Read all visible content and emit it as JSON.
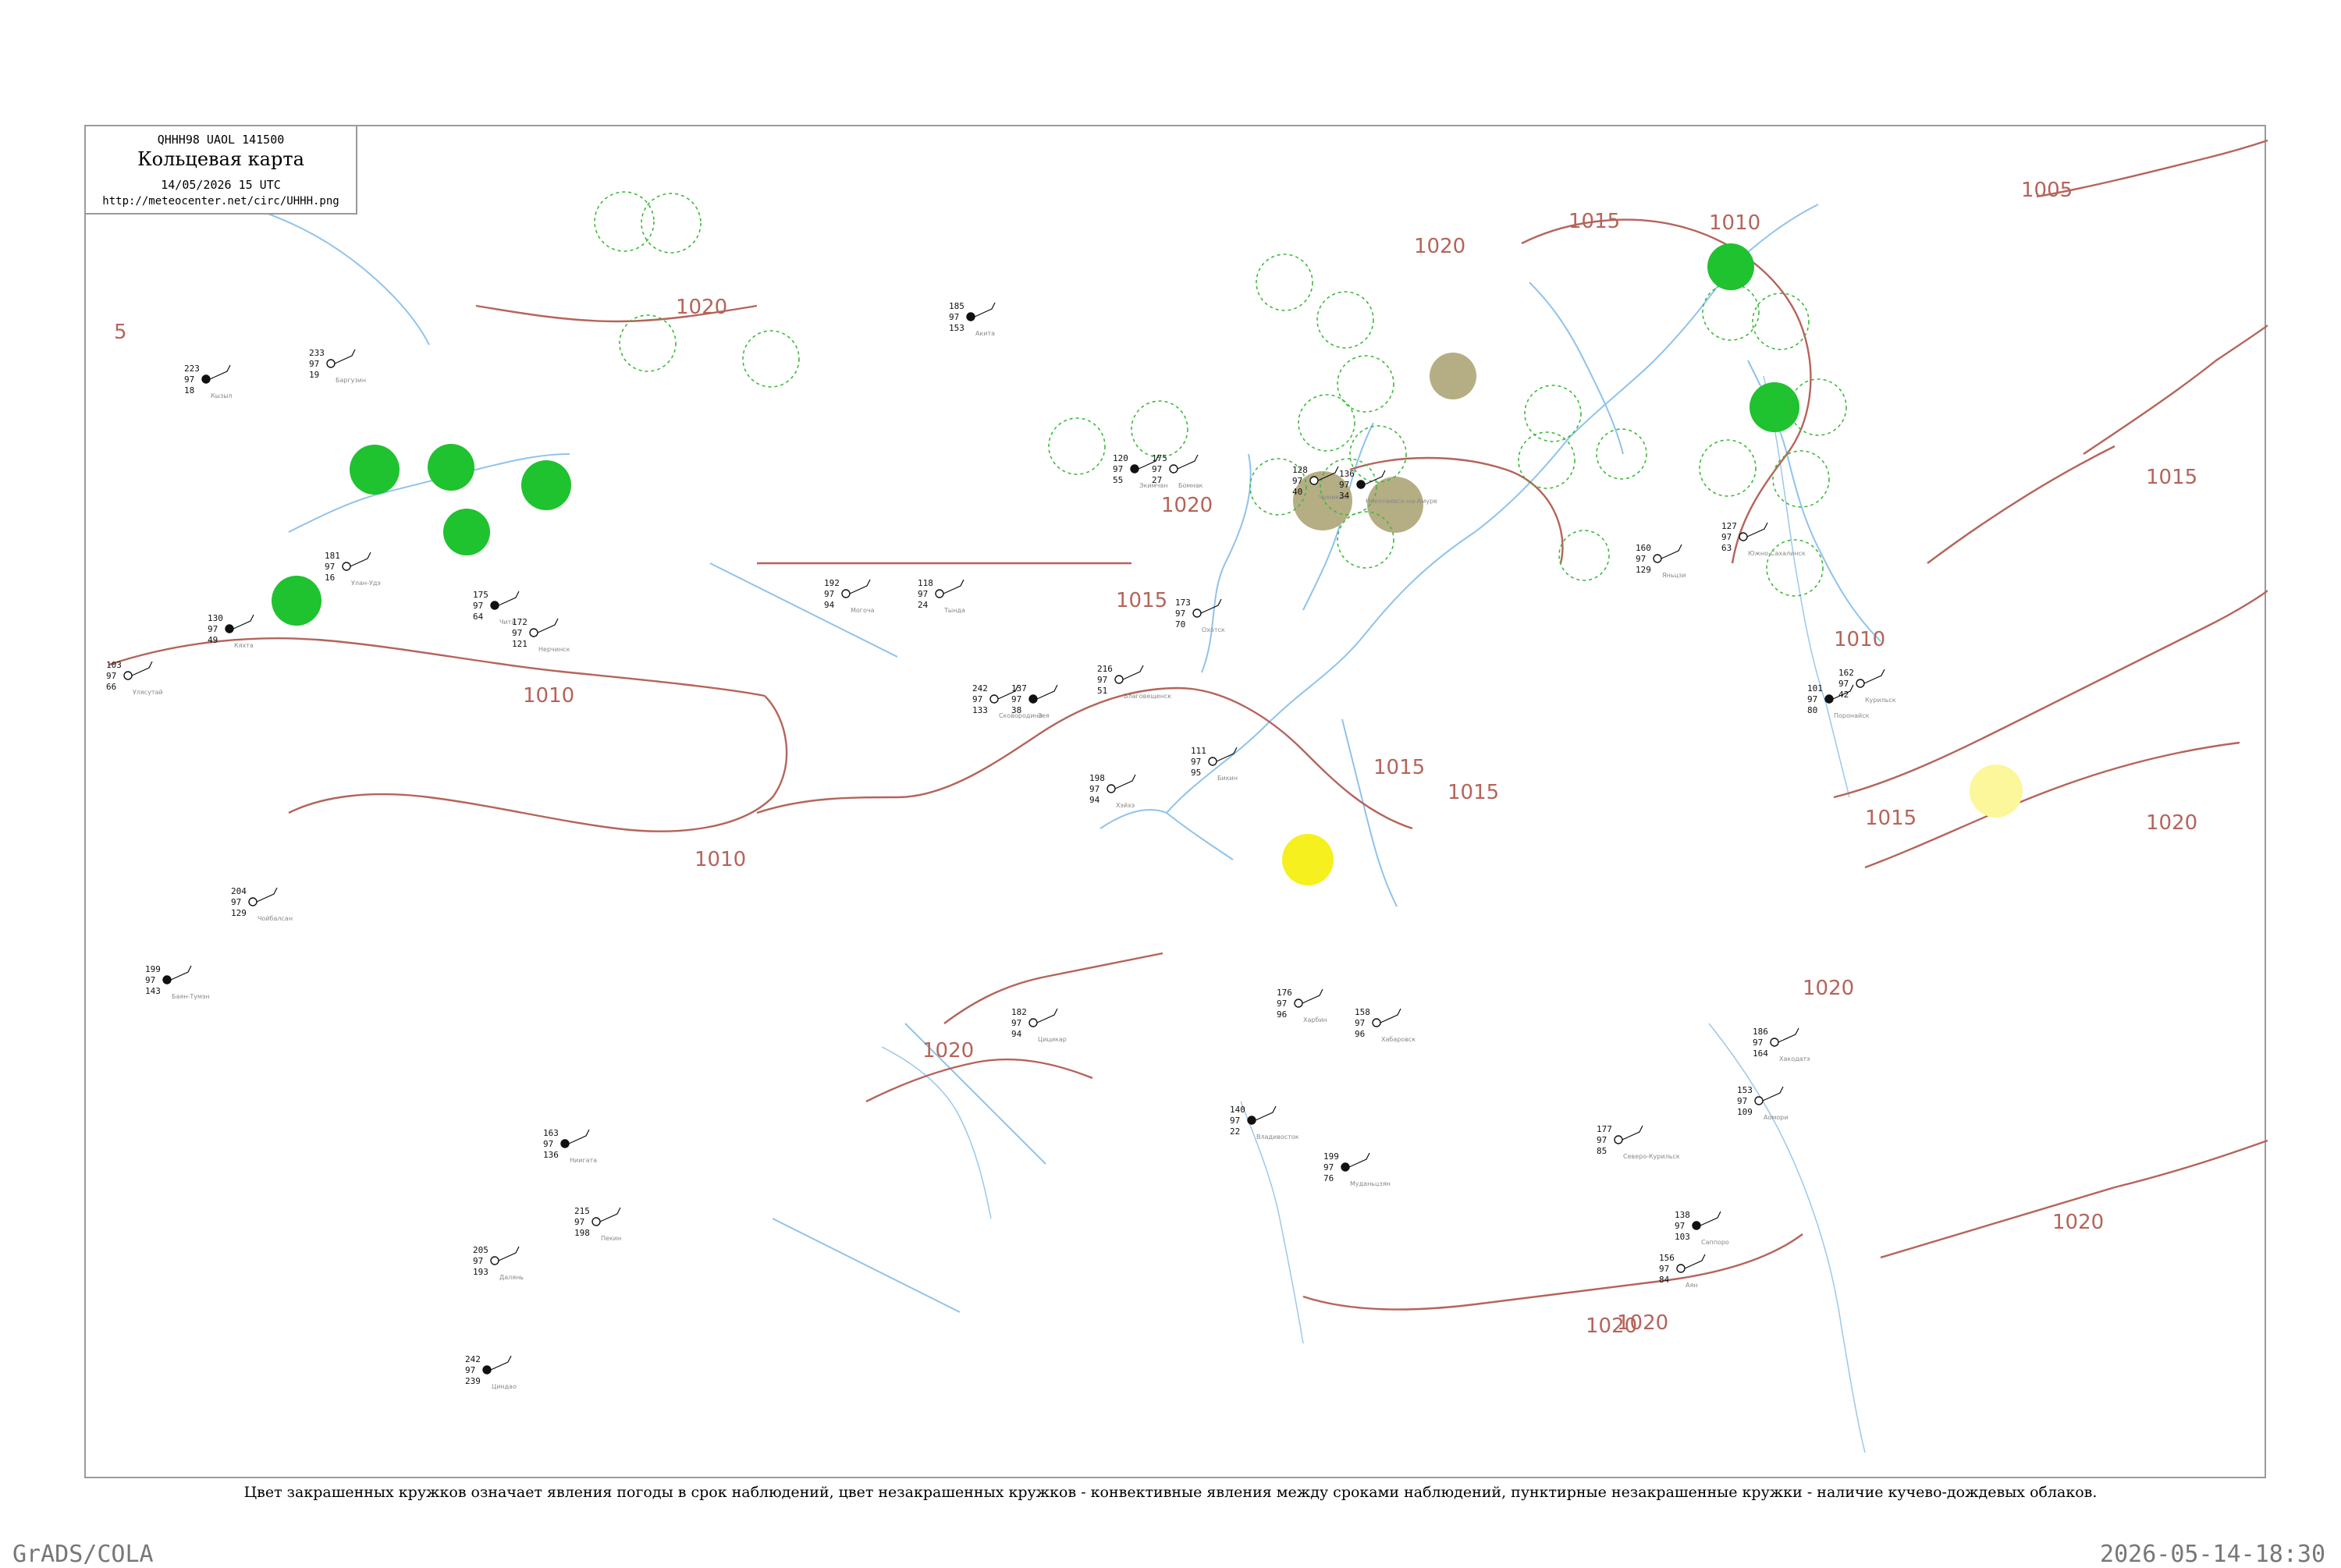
{
  "header": {
    "code": "QHHH98 UAOL 141500",
    "title": "Кольцевая карта",
    "date": "14/05/2026 15 UTC",
    "url": "http://meteocenter.net/circ/UHHH.png"
  },
  "footnote": "Цвет закрашенных кружков означает явления погоды в срок наблюдений, цвет незакрашенных кружков - конвективные явления между сроками наблюдений, пунктирные незакрашенные кружки - наличие кучево-дождевых облаков.",
  "footer": {
    "left": "GrADS/COLA",
    "right": "2026-05-14-18:30"
  },
  "colors": {
    "isobar": "#b5645a",
    "river": "#8fc3ec",
    "precip_green": "#1fc22f",
    "thunder_olive": "#b5ae84",
    "shower_yellow": "#f5f01e",
    "cb_dashed": "#3cba3c"
  },
  "isobars": [
    {
      "label": "1005",
      "name": "isobar-1005"
    },
    {
      "label": "1010",
      "name": "isobar-1010"
    },
    {
      "label": "1015",
      "name": "isobar-1015"
    },
    {
      "label": "1020",
      "name": "isobar-1020"
    },
    {
      "label": "5",
      "name": "isobar-partial"
    }
  ],
  "stations": [
    {
      "t": "223",
      "p": "97",
      "d": "18",
      "name": "Кызыл"
    },
    {
      "t": "233",
      "p": "97",
      "d": "19",
      "name": "Баргузин"
    },
    {
      "t": "181",
      "p": "97",
      "d": "16",
      "name": "Улан-Удэ"
    },
    {
      "t": "130",
      "p": "97",
      "d": "49",
      "name": "Кяхта"
    },
    {
      "t": "103",
      "p": "97",
      "d": "66",
      "name": "Улясутай"
    },
    {
      "t": "204",
      "p": "97",
      "d": "129",
      "name": "Чойбалсан"
    },
    {
      "t": "199",
      "p": "97",
      "d": "143",
      "name": "Баян-Тумэн"
    },
    {
      "t": "192",
      "p": "97",
      "d": "94",
      "name": "Могоча"
    },
    {
      "t": "118",
      "p": "97",
      "d": "24",
      "name": "Тында"
    },
    {
      "t": "175",
      "p": "97",
      "d": "64",
      "name": "Чита"
    },
    {
      "t": "172",
      "p": "97",
      "d": "121",
      "name": "Нерчинск"
    },
    {
      "t": "242",
      "p": "97",
      "d": "133",
      "name": "Сковородино"
    },
    {
      "t": "137",
      "p": "97",
      "d": "38",
      "name": "Зея"
    },
    {
      "t": "216",
      "p": "97",
      "d": "51",
      "name": "Благовещенск"
    },
    {
      "t": "198",
      "p": "97",
      "d": "94",
      "name": "Хэйхэ"
    },
    {
      "t": "120",
      "p": "97",
      "d": "55",
      "name": "Экимчан"
    },
    {
      "t": "175",
      "p": "97",
      "d": "27",
      "name": "Бомнак"
    },
    {
      "t": "128",
      "p": "97",
      "d": "40",
      "name": "Чумикан"
    },
    {
      "t": "136",
      "p": "97",
      "d": "34",
      "name": "Николаевск-на-Амуре"
    },
    {
      "t": "158",
      "p": "97",
      "d": "96",
      "name": "Хабаровск"
    },
    {
      "t": "111",
      "p": "97",
      "d": "95",
      "name": "Бикин"
    },
    {
      "t": "140",
      "p": "97",
      "d": "22",
      "name": "Владивосток"
    },
    {
      "t": "176",
      "p": "97",
      "d": "96",
      "name": "Харбин"
    },
    {
      "t": "182",
      "p": "97",
      "d": "94",
      "name": "Цицикар"
    },
    {
      "t": "199",
      "p": "97",
      "d": "76",
      "name": "Муданьцзян"
    },
    {
      "t": "160",
      "p": "97",
      "d": "129",
      "name": "Яньцзи"
    },
    {
      "t": "127",
      "p": "97",
      "d": "63",
      "name": "Южно-Сахалинск"
    },
    {
      "t": "101",
      "p": "97",
      "d": "80",
      "name": "Поронайск"
    },
    {
      "t": "162",
      "p": "97",
      "d": "42",
      "name": "Курильск"
    },
    {
      "t": "177",
      "p": "97",
      "d": "85",
      "name": "Северо-Курильск"
    },
    {
      "t": "138",
      "p": "97",
      "d": "103",
      "name": "Саппоро"
    },
    {
      "t": "186",
      "p": "97",
      "d": "164",
      "name": "Хакодатэ"
    },
    {
      "t": "153",
      "p": "97",
      "d": "109",
      "name": "Аомори"
    },
    {
      "t": "185",
      "p": "97",
      "d": "153",
      "name": "Акита"
    },
    {
      "t": "173",
      "p": "97",
      "d": "70",
      "name": "Охотск"
    },
    {
      "t": "156",
      "p": "97",
      "d": "84",
      "name": "Аян"
    },
    {
      "t": "163",
      "p": "97",
      "d": "136",
      "name": "Ниигата"
    },
    {
      "t": "215",
      "p": "97",
      "d": "198",
      "name": "Пекин"
    },
    {
      "t": "205",
      "p": "97",
      "d": "193",
      "name": "Далянь"
    },
    {
      "t": "242",
      "p": "97",
      "d": "239",
      "name": "Циндао"
    }
  ],
  "station_names": [
    "Кызыл",
    "Баргузин",
    "Улан-Удэ",
    "Кяхта",
    "Чита",
    "Могоча",
    "Тында",
    "Зея",
    "Благовещенск",
    "Хабаровск",
    "Бикин",
    "Владивосток",
    "Харбин",
    "Южно-Сахалинск",
    "Николаевск-на-Амуре",
    "Поронайск",
    "Курильск",
    "Северо-Курильск",
    "Саппоро",
    "Охотск",
    "Аян"
  ],
  "legend_marks": {
    "green_filled": "precipitation",
    "olive_filled": "thunderstorm",
    "yellow_filled": "shower",
    "dashed_circle": "cumulonimbus"
  }
}
